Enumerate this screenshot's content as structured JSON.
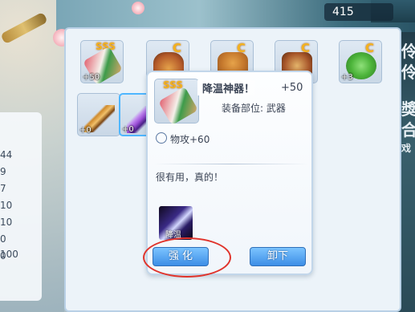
{
  "hud": {
    "counter": "415"
  },
  "stats": {
    "lines": [
      "44",
      "9",
      "7",
      "10",
      "10",
      "0",
      "0",
      "100"
    ]
  },
  "inventory": {
    "items": [
      {
        "name": "sss-item-1",
        "tag": "SSS",
        "plus": "+50",
        "colors": [
          "#e05a6a",
          "#3c9b4a"
        ]
      },
      {
        "name": "c-item-2",
        "tag": "C",
        "plus": "",
        "colors": [
          "#b45a2a",
          "#e6a34a"
        ]
      },
      {
        "name": "c-item-3",
        "tag": "C",
        "plus": "",
        "colors": [
          "#c4772c",
          "#8a4d1f"
        ]
      },
      {
        "name": "c-item-4",
        "tag": "C",
        "plus": "",
        "colors": [
          "#a7562a",
          "#e3b46a"
        ]
      },
      {
        "name": "c-item-5",
        "tag": "C",
        "plus": "+3",
        "colors": [
          "#4cb43a",
          "#2f7a26"
        ]
      },
      {
        "name": "weapon-item-6",
        "tag": "",
        "plus": "+0",
        "colors": [
          "#d08b2d",
          "#7a4514"
        ]
      },
      {
        "name": "weapon-item-7",
        "tag": "",
        "plus": "+0",
        "colors": [
          "#9b4fd6",
          "#4a1f88"
        ]
      }
    ]
  },
  "tooltip": {
    "tag": "SSS",
    "name": "降温神器！",
    "level": "+50",
    "slot_label": "装备部位: 武器",
    "attack": "物攻+60",
    "description": "很有用，真的！",
    "skill_label": "降温",
    "buttons": {
      "upgrade": "强 化",
      "unequip": "卸下"
    }
  },
  "right_panel": {
    "chars": [
      "伶",
      "伶",
      "獎",
      "合",
      "戏"
    ]
  }
}
